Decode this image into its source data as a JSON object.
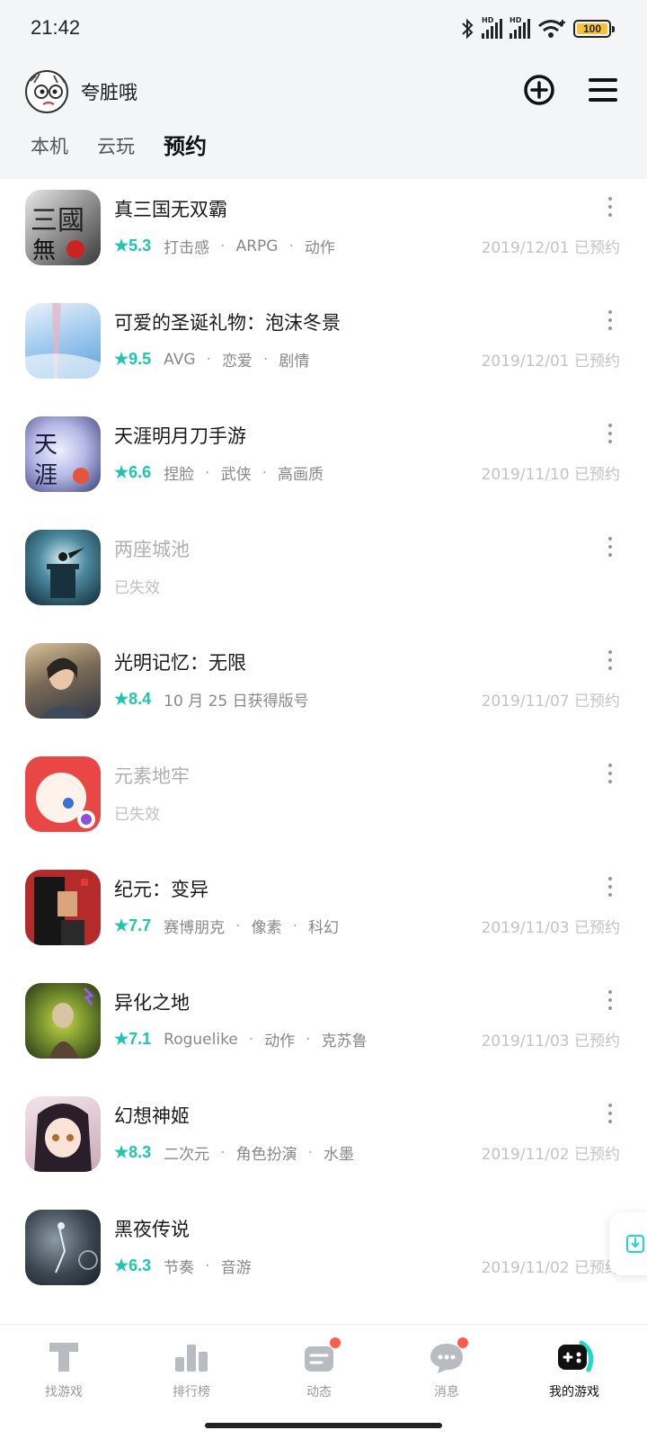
{
  "status_bar": {
    "time": "21:42",
    "battery": "100",
    "icons": [
      "bluetooth-icon",
      "signal-hd-icon",
      "signal-hd-icon",
      "wifi-icon",
      "battery-icon"
    ]
  },
  "header": {
    "username": "夸脏哦",
    "add_icon": "plus-circle-icon",
    "menu_icon": "hamburger-menu-icon"
  },
  "tabs": [
    {
      "label": "本机",
      "active": false
    },
    {
      "label": "云玩",
      "active": false
    },
    {
      "label": "预约",
      "active": true
    }
  ],
  "accent_color": "#1ed9c8",
  "score_color": "#1fc6ae",
  "games": [
    {
      "title": "真三国无双霸",
      "score": "★5.3",
      "tags": [
        "打击感",
        "ARPG",
        "动作"
      ],
      "date": "2019/12/01 已预约",
      "invalid": false
    },
    {
      "title": "可爱的圣诞礼物：泡沫冬景",
      "score": "★9.5",
      "tags": [
        "AVG",
        "恋爱",
        "剧情"
      ],
      "date": "2019/12/01 已预约",
      "invalid": false
    },
    {
      "title": "天涯明月刀手游",
      "score": "★6.6",
      "tags": [
        "捏脸",
        "武侠",
        "高画质"
      ],
      "date": "2019/11/10 已预约",
      "invalid": false
    },
    {
      "title": "两座城池",
      "status": "已失效",
      "invalid": true
    },
    {
      "title": "光明记忆：无限",
      "score": "★8.4",
      "note": "10 月 25 日获得版号",
      "date": "2019/11/07 已预约",
      "invalid": false
    },
    {
      "title": "元素地牢",
      "status": "已失效",
      "invalid": true
    },
    {
      "title": "纪元：变异",
      "score": "★7.7",
      "tags": [
        "赛博朋克",
        "像素",
        "科幻"
      ],
      "date": "2019/11/03 已预约",
      "invalid": false
    },
    {
      "title": "异化之地",
      "score": "★7.1",
      "tags": [
        "Roguelike",
        "动作",
        "克苏鲁"
      ],
      "date": "2019/11/03 已预约",
      "invalid": false
    },
    {
      "title": "幻想神姬",
      "score": "★8.3",
      "tags": [
        "二次元",
        "角色扮演",
        "水墨"
      ],
      "date": "2019/11/02 已预约",
      "invalid": false
    },
    {
      "title": "黑夜传说",
      "score": "★6.3",
      "tags": [
        "节奏",
        "音游"
      ],
      "date": "2019/11/02 已预约",
      "invalid": false
    }
  ],
  "bottom_nav": [
    {
      "label": "找游戏",
      "icon": "find-game-icon",
      "badge": false,
      "active": false
    },
    {
      "label": "排行榜",
      "icon": "ranking-icon",
      "badge": false,
      "active": false
    },
    {
      "label": "动态",
      "icon": "feed-icon",
      "badge": true,
      "active": false
    },
    {
      "label": "消息",
      "icon": "message-icon",
      "badge": true,
      "active": false
    },
    {
      "label": "我的游戏",
      "icon": "my-games-icon",
      "badge": false,
      "active": true
    }
  ]
}
